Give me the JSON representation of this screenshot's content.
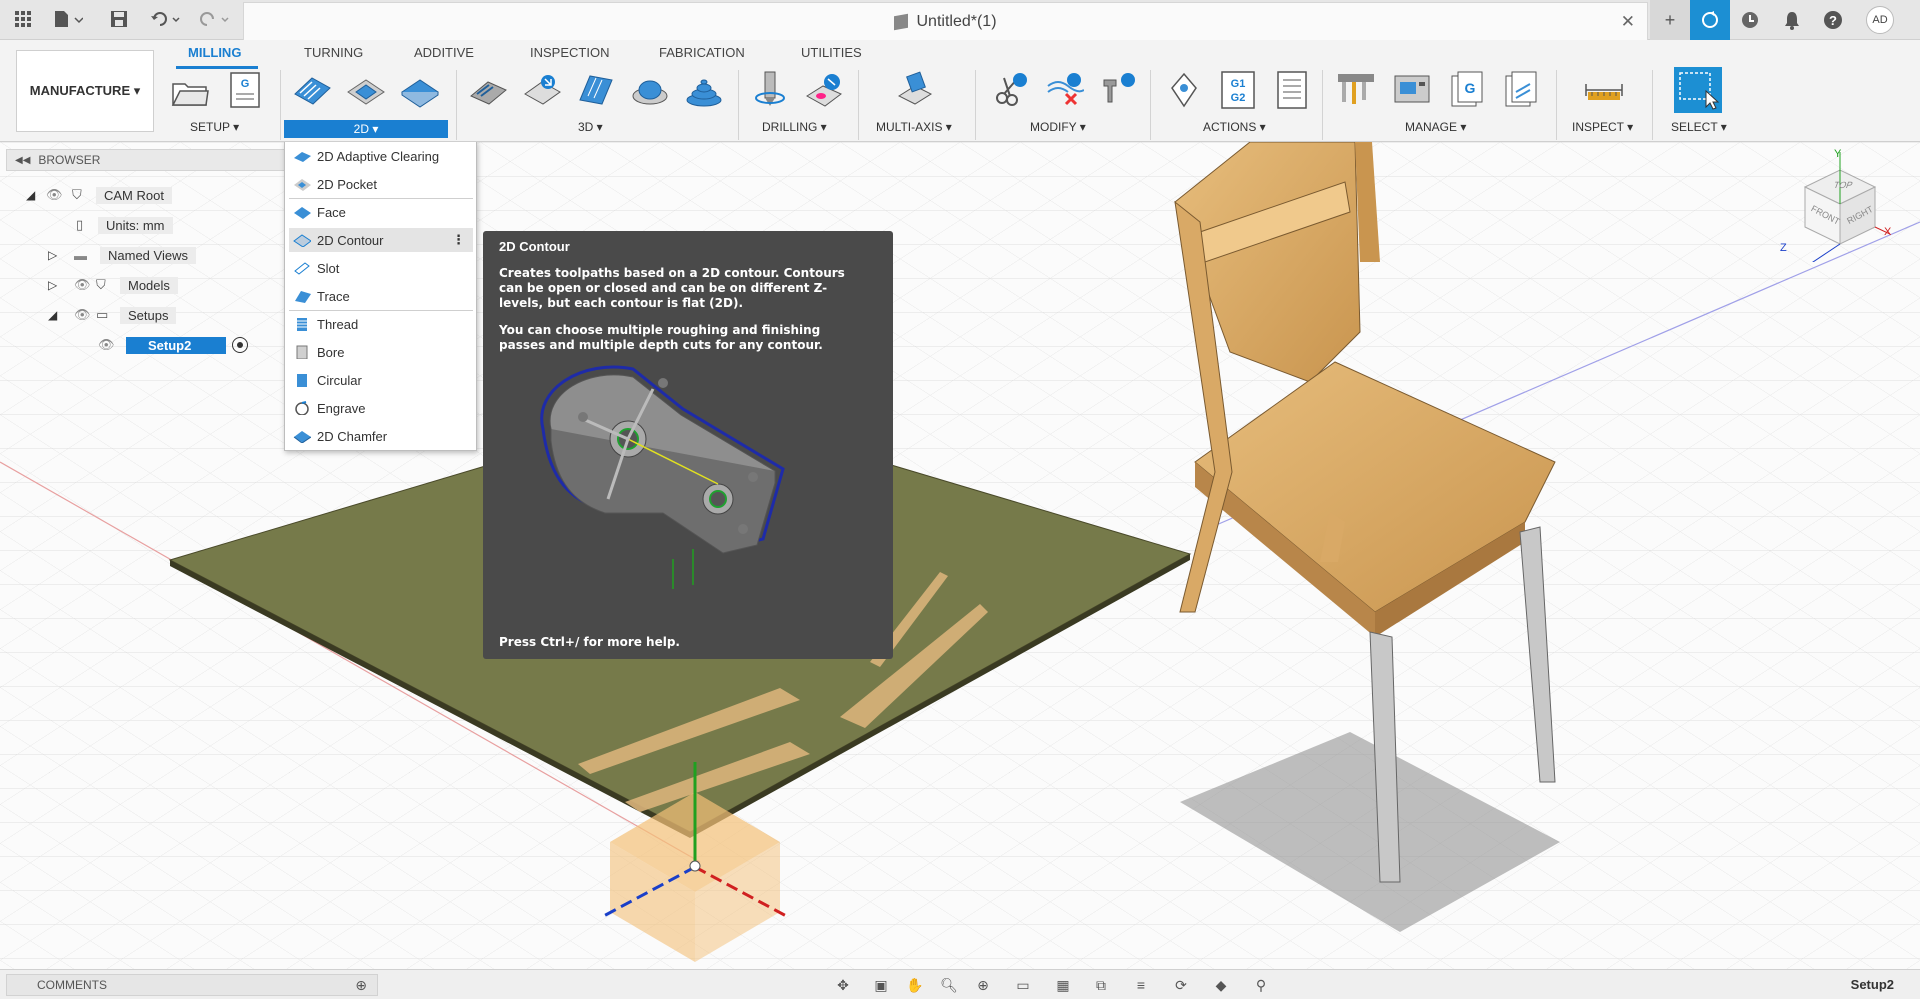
{
  "app": {
    "doc_title": "Untitled*(1)",
    "user_initials": "AD"
  },
  "ribbon": {
    "workspace": "MANUFACTURE ▾",
    "tabs": [
      "MILLING",
      "TURNING",
      "ADDITIVE",
      "INSPECTION",
      "FABRICATION",
      "UTILITIES"
    ],
    "groups": {
      "setup": "SETUP ▾",
      "twod": "2D ▾",
      "threed": "3D ▾",
      "drilling": "DRILLING ▾",
      "multiaxis": "MULTI-AXIS ▾",
      "modify": "MODIFY ▾",
      "actions": "ACTIONS ▾",
      "manage": "MANAGE ▾",
      "inspect": "INSPECT ▾",
      "select": "SELECT ▾"
    },
    "g1g2": "G1\nG2"
  },
  "browser": {
    "title": "BROWSER",
    "items": {
      "cam_root": "CAM Root",
      "units": "Units: mm",
      "named_views": "Named Views",
      "models": "Models",
      "setups": "Setups",
      "setup2": "Setup2"
    }
  },
  "dropdown": {
    "items": [
      "2D Adaptive Clearing",
      "2D Pocket",
      "Face",
      "2D Contour",
      "Slot",
      "Trace",
      "Thread",
      "Bore",
      "Circular",
      "Engrave",
      "2D Chamfer"
    ],
    "hovered": "2D Contour"
  },
  "tooltip": {
    "title": "2D Contour",
    "para1": "Creates toolpaths based on a 2D contour. Contours can be open or closed and can be on different Z-levels, but each contour is flat (2D).",
    "para2": "You can choose multiple roughing and finishing passes and multiple depth cuts for any contour.",
    "help": "Press Ctrl+/ for more help."
  },
  "viewcube": {
    "top": "TOP",
    "front": "FRONT",
    "right": "RIGHT",
    "axis_x": "X",
    "axis_y": "Y",
    "axis_z": "Z"
  },
  "bottom": {
    "comments": "COMMENTS",
    "status": "Setup2"
  },
  "colors": {
    "accent": "#1a7fd1",
    "stock": "#767a4a",
    "wood": "#d9ab6a"
  }
}
